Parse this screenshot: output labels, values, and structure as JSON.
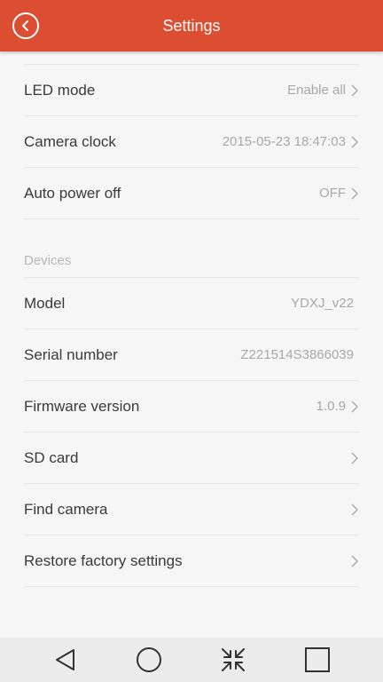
{
  "header": {
    "title": "Settings"
  },
  "settings": {
    "rows": [
      {
        "label": "LED mode",
        "value": "Enable all"
      },
      {
        "label": "Camera clock",
        "value": "2015-05-23 18:47:03"
      },
      {
        "label": "Auto power off",
        "value": "OFF"
      }
    ]
  },
  "devices": {
    "section_title": "Devices",
    "rows": [
      {
        "label": "Model",
        "value": "YDXJ_v22"
      },
      {
        "label": "Serial number",
        "value": "Z221514S3866039"
      },
      {
        "label": "Firmware version",
        "value": "1.0.9"
      },
      {
        "label": "SD card",
        "value": ""
      },
      {
        "label": "Find camera",
        "value": ""
      },
      {
        "label": "Restore factory settings",
        "value": ""
      }
    ]
  },
  "navbar": {
    "icons": [
      "back-triangle-icon",
      "home-circle-icon",
      "collapse-arrows-icon",
      "recents-square-icon"
    ]
  },
  "colors": {
    "header": "#dc4e31",
    "label": "#3a3a3a",
    "value": "#a8a8a8",
    "section": "#b8b8b8",
    "divider": "#e6e6e6"
  }
}
